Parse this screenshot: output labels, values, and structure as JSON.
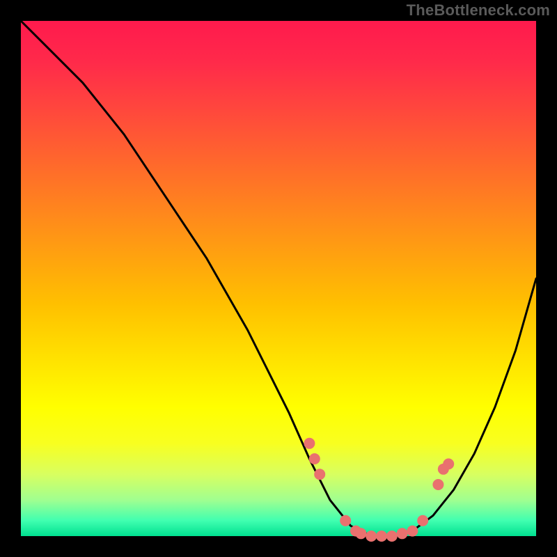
{
  "watermark": "TheBottleneck.com",
  "chart_data": {
    "type": "line",
    "title": "",
    "xlabel": "",
    "ylabel": "",
    "xlim": [
      0,
      100
    ],
    "ylim": [
      0,
      100
    ],
    "curve": {
      "x": [
        0,
        4,
        8,
        12,
        16,
        20,
        24,
        28,
        32,
        36,
        40,
        44,
        48,
        52,
        56,
        60,
        64,
        68,
        72,
        76,
        80,
        84,
        88,
        92,
        96,
        100
      ],
      "y": [
        100,
        96,
        92,
        88,
        83,
        78,
        72,
        66,
        60,
        54,
        47,
        40,
        32,
        24,
        15,
        7,
        2,
        0,
        0,
        1,
        4,
        9,
        16,
        25,
        36,
        50
      ]
    },
    "dots": [
      {
        "x": 56,
        "y": 18
      },
      {
        "x": 57,
        "y": 15
      },
      {
        "x": 58,
        "y": 12
      },
      {
        "x": 63,
        "y": 3
      },
      {
        "x": 65,
        "y": 1
      },
      {
        "x": 66,
        "y": 0.5
      },
      {
        "x": 68,
        "y": 0
      },
      {
        "x": 70,
        "y": 0
      },
      {
        "x": 72,
        "y": 0
      },
      {
        "x": 74,
        "y": 0.5
      },
      {
        "x": 76,
        "y": 1
      },
      {
        "x": 78,
        "y": 3
      },
      {
        "x": 81,
        "y": 10
      },
      {
        "x": 82,
        "y": 13
      },
      {
        "x": 83,
        "y": 14
      }
    ],
    "colors": {
      "curve": "#000000",
      "dots": "#e9716f",
      "gradient_top": "#ff1a4d",
      "gradient_bottom": "#00e090"
    }
  }
}
